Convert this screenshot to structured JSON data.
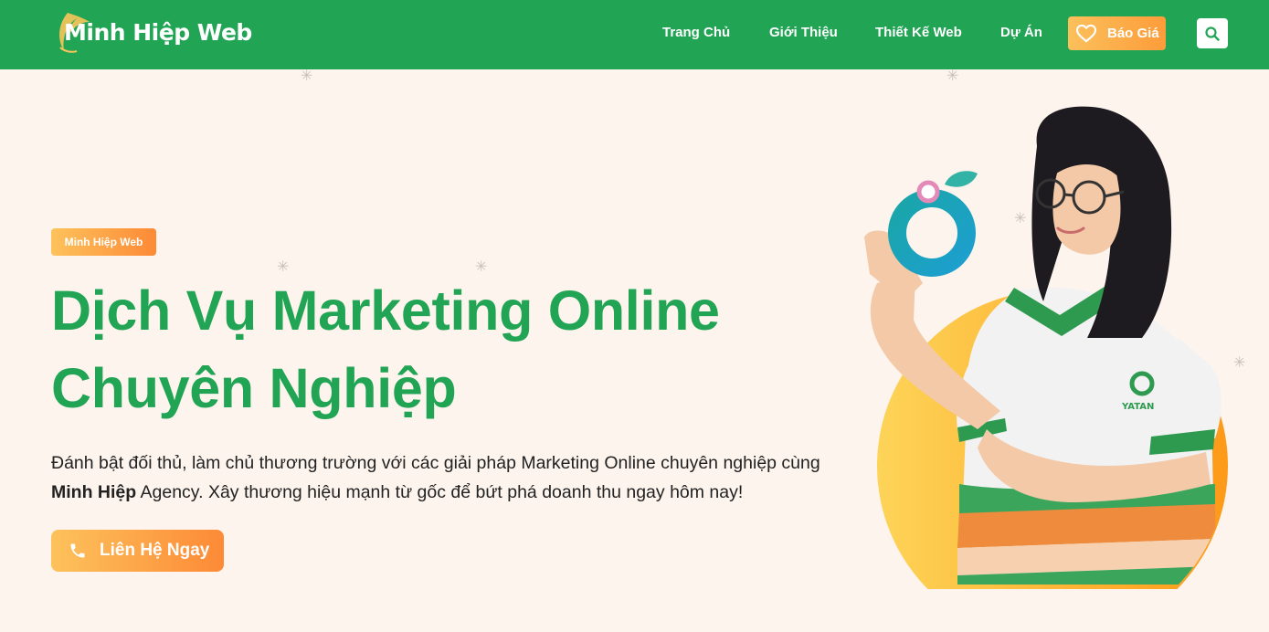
{
  "header": {
    "logo_text": "Minh Hiệp Web",
    "nav": [
      "Trang Chủ",
      "Giới Thiệu",
      "Thiết Kế Web",
      "Dự Án"
    ],
    "quote_button": "Báo Giá"
  },
  "hero": {
    "badge": "Minh Hiệp Web",
    "title_line1": "Dịch Vụ Marketing Online",
    "title_line2": "Chuyên Nghiệp",
    "desc_part1": "Đánh bật đối thủ, làm chủ thương trường với các giải pháp Marketing Online chuyên nghiệp cùng ",
    "desc_bold": "Minh Hiệp",
    "desc_part2": " Agency. Xây thương hiệu mạnh từ gốc để bứt phá doanh thu ngay hôm nay!",
    "cta": "Liên Hệ Ngay"
  },
  "illustration": {
    "shirt_text": "YATAN"
  },
  "colors": {
    "brand_green": "#22a455",
    "accent_orange": "#fd9c3a",
    "accent_yellow": "#fdc25c",
    "background": "#fdf4ee"
  },
  "icons": [
    "logo-leaf-icon",
    "heart-icon",
    "search-icon",
    "phone-icon",
    "sparkle-icon"
  ]
}
